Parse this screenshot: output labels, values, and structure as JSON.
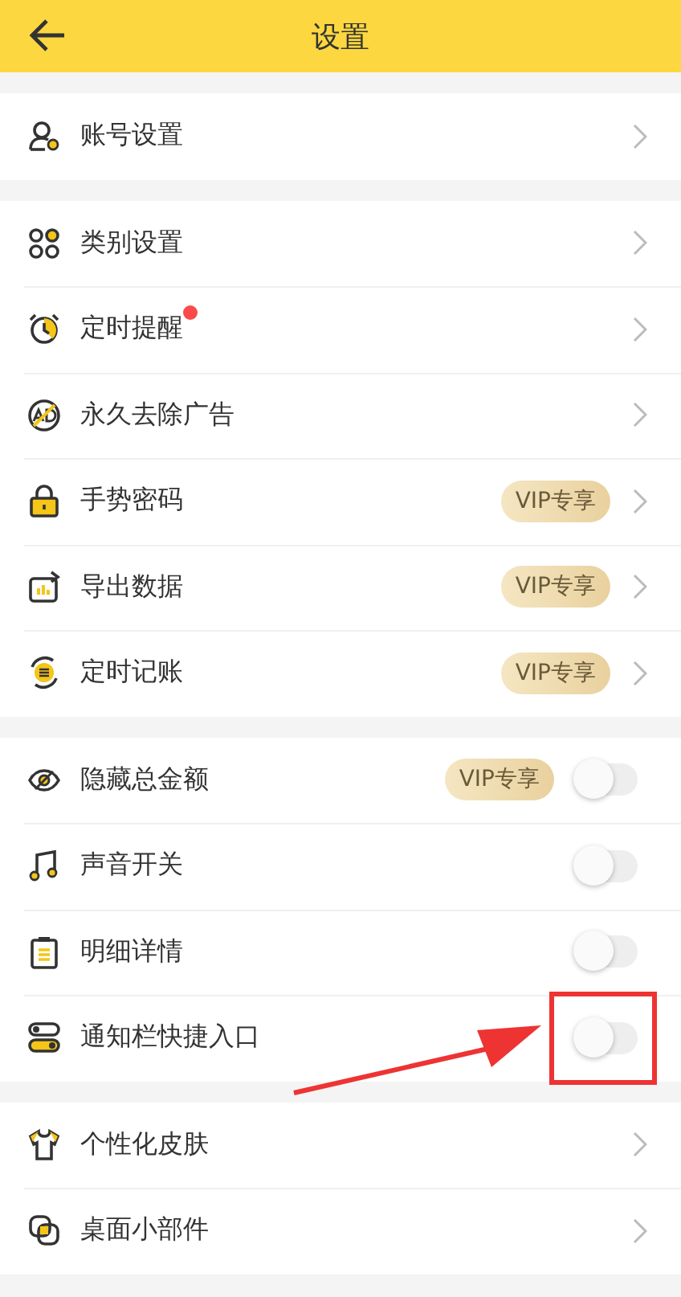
{
  "header": {
    "title": "设置"
  },
  "sections": [
    {
      "items": [
        {
          "label": "账号设置",
          "kind": "link",
          "unread": false,
          "highlighted": false
        }
      ]
    },
    {
      "items": [
        {
          "label": "类别设置",
          "kind": "link",
          "unread": false,
          "highlighted": false
        },
        {
          "label": "定时提醒",
          "kind": "link",
          "unread": true,
          "highlighted": false
        },
        {
          "label": "永久去除广告",
          "kind": "link",
          "unread": false,
          "highlighted": false
        },
        {
          "label": "手势密码",
          "kind": "link",
          "badge": "VIP专享",
          "unread": false,
          "highlighted": false
        },
        {
          "label": "导出数据",
          "kind": "link",
          "badge": "VIP专享",
          "unread": false,
          "highlighted": false
        },
        {
          "label": "定时记账",
          "kind": "link",
          "badge": "VIP专享",
          "unread": false,
          "highlighted": false
        }
      ]
    },
    {
      "items": [
        {
          "label": "隐藏总金额",
          "kind": "switch",
          "badge": "VIP专享",
          "on": false,
          "unread": false,
          "highlighted": false
        },
        {
          "label": "声音开关",
          "kind": "switch",
          "on": false,
          "unread": false,
          "highlighted": false
        },
        {
          "label": "明细详情",
          "kind": "switch",
          "on": false,
          "unread": false,
          "highlighted": false
        },
        {
          "label": "通知栏快捷入口",
          "kind": "switch",
          "on": false,
          "unread": false,
          "highlighted": true
        }
      ]
    },
    {
      "items": [
        {
          "label": "个性化皮肤",
          "kind": "link",
          "unread": false,
          "highlighted": false
        },
        {
          "label": "桌面小部件",
          "kind": "link",
          "unread": false,
          "highlighted": false
        }
      ]
    }
  ]
}
